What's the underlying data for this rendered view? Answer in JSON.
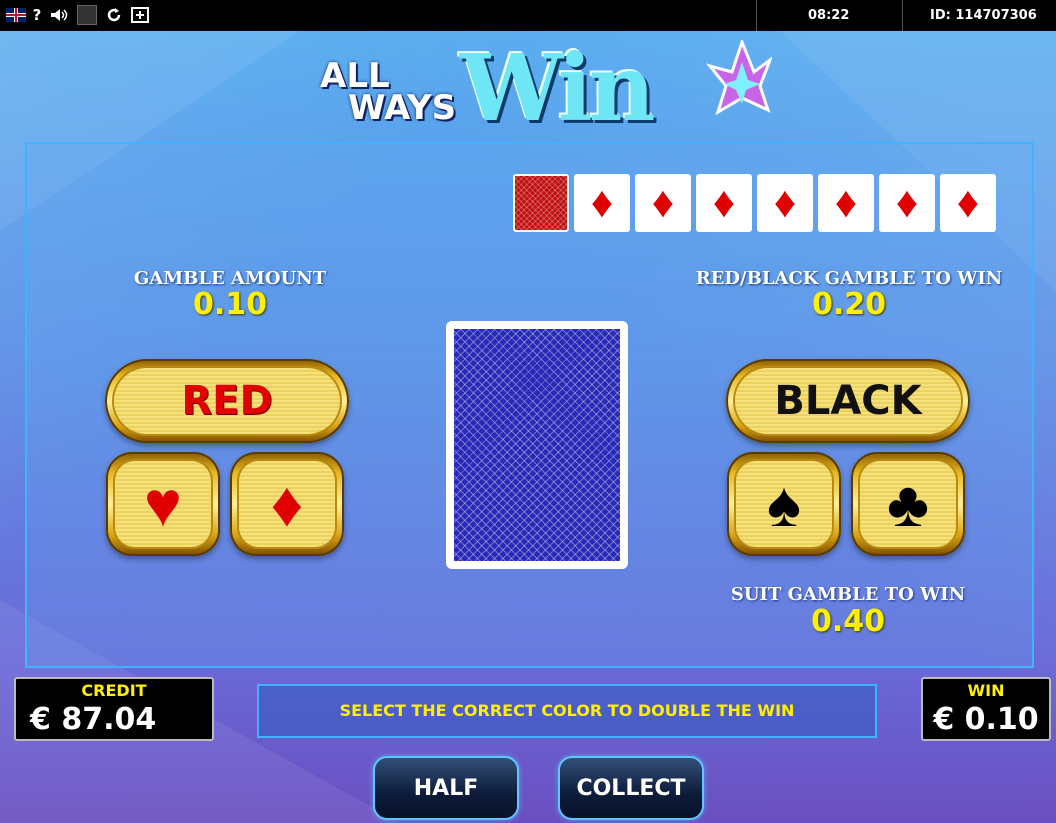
{
  "topbar": {
    "icons": [
      "uk-flag-icon",
      "help-icon",
      "sound-icon",
      "blank-square-icon",
      "reload-icon",
      "fullscreen-icon"
    ],
    "help_glyph": "?",
    "time": "08:22",
    "session_id": "ID: 114707306"
  },
  "logo": {
    "line1": "ALL",
    "line2": "WAYS",
    "word": "Win"
  },
  "history": {
    "cards": [
      "back",
      "diamond",
      "diamond",
      "diamond",
      "diamond",
      "diamond",
      "diamond",
      "diamond"
    ],
    "diamond_glyph": "♦"
  },
  "gamble": {
    "amount_label": "GAMBLE AMOUNT",
    "amount_value": "0.10",
    "redblack_label": "RED/BLACK GAMBLE TO WIN",
    "redblack_value": "0.20",
    "suit_label": "SUIT GAMBLE TO WIN",
    "suit_value": "0.40"
  },
  "buttons": {
    "red": "RED",
    "black": "BLACK",
    "hearts": "♥",
    "diamonds": "♦",
    "spades": "♠",
    "clubs": "♣",
    "half": "HALF",
    "collect": "COLLECT"
  },
  "meters": {
    "credit_label": "CREDIT",
    "credit_value": "€ 87.04",
    "win_label": "WIN",
    "win_value": "€ 0.10"
  },
  "message": "SELECT THE CORRECT COLOR TO DOUBLE THE WIN",
  "colors": {
    "accent_yellow": "#ffef00",
    "red": "#e00000",
    "panel_border": "#3fb3ff"
  }
}
